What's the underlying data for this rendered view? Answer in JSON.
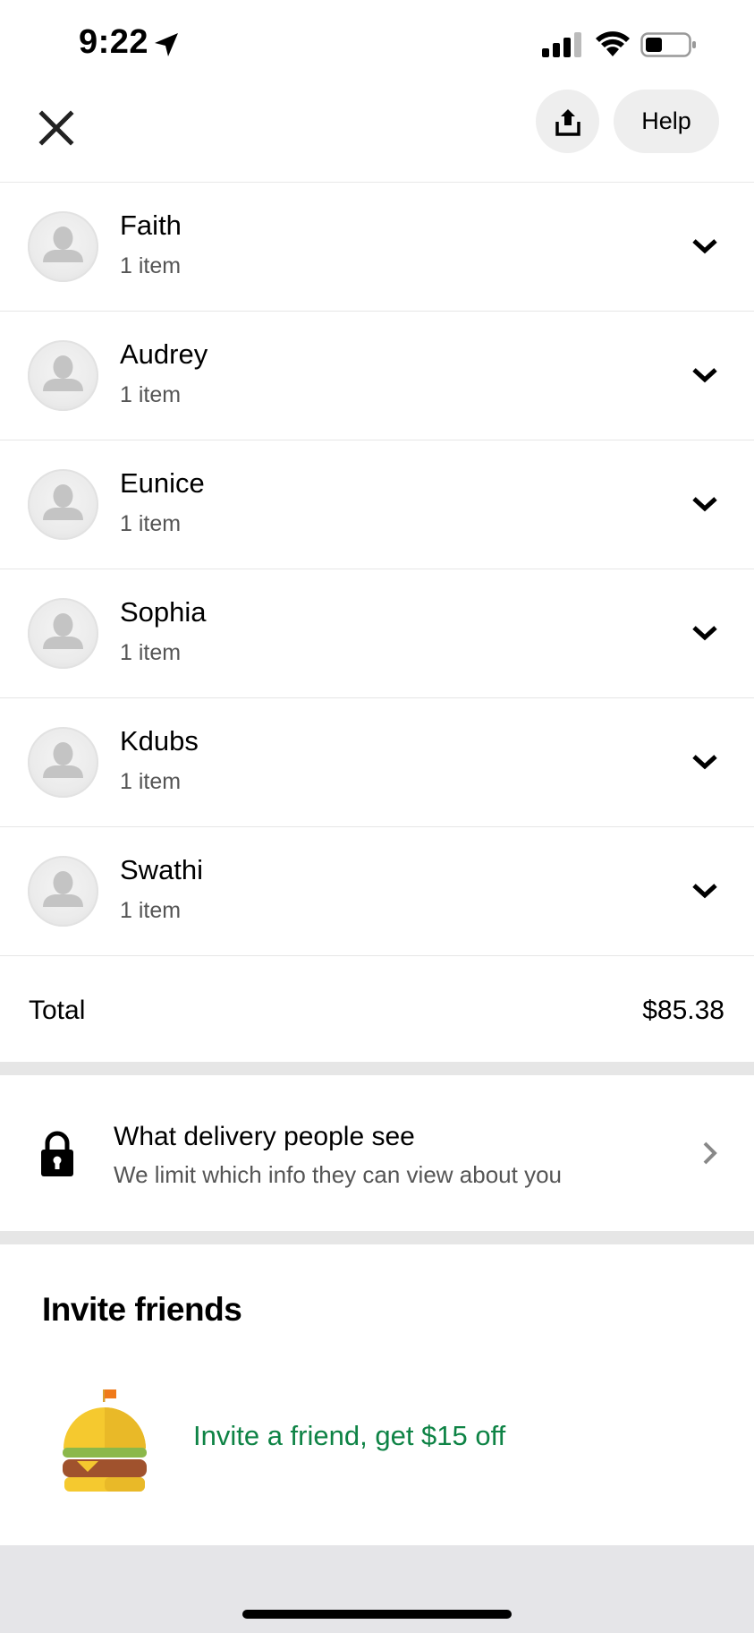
{
  "status_bar": {
    "time": "9:22",
    "icons": [
      "location-arrow-icon",
      "cellular-signal-icon",
      "wifi-icon",
      "battery-icon"
    ]
  },
  "header": {
    "close_icon": "close-icon",
    "share_icon": "share-icon",
    "help_label": "Help"
  },
  "members": [
    {
      "name": "Faith",
      "count": "1 item"
    },
    {
      "name": "Audrey",
      "count": "1 item"
    },
    {
      "name": "Eunice",
      "count": "1 item"
    },
    {
      "name": "Sophia",
      "count": "1 item"
    },
    {
      "name": "Kdubs",
      "count": "1 item"
    },
    {
      "name": "Swathi",
      "count": "1 item"
    }
  ],
  "total": {
    "label": "Total",
    "value": "$85.38"
  },
  "privacy": {
    "title": "What delivery people see",
    "subtitle": "We limit which info they can view about you"
  },
  "invite": {
    "title": "Invite friends",
    "link": "Invite a friend, get $15 off",
    "link_color": "#0e8345"
  },
  "colors": {
    "button_bg": "#eeeeee",
    "divider": "#e6e6e6",
    "accent_green": "#0e8345"
  }
}
